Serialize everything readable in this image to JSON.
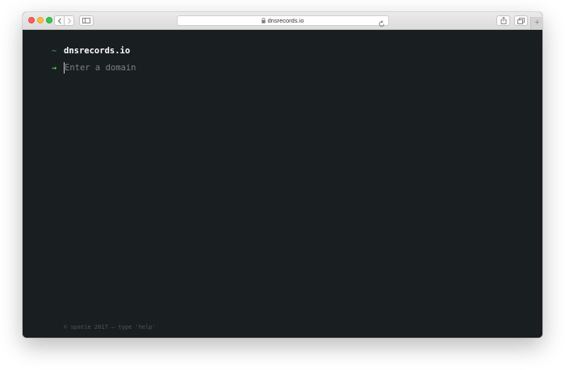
{
  "browser": {
    "url": "dnsrecords.io",
    "icons": {
      "lock": "lock-icon",
      "reload": "reload-icon",
      "back": "chevron-left-icon",
      "forward": "chevron-right-icon",
      "sidebar": "sidebar-icon",
      "share": "share-icon",
      "tabs": "tabs-overview-icon",
      "new_tab": "plus-icon"
    },
    "new_tab_label": "+"
  },
  "terminal": {
    "title_prefix": "~",
    "site_title": "dnsrecords.io",
    "input_prefix": "→",
    "input_value": "",
    "input_placeholder": "Enter a domain",
    "footer": "© spatie 2017 — type 'help'"
  },
  "colors": {
    "background": "#191e20",
    "tilde": "#38b6b0",
    "arrow": "#4fd34d",
    "title": "#ffffff",
    "placeholder": "#7b8183",
    "footer": "#50575a"
  }
}
